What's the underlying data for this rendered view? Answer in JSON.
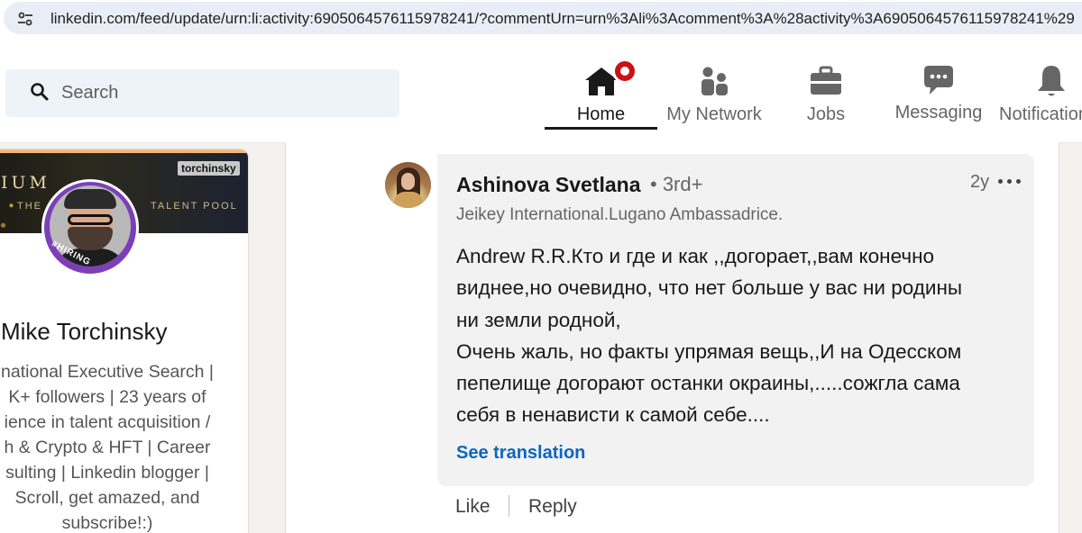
{
  "browser": {
    "url": "linkedin.com/feed/update/urn:li:activity:6905064576115978241/?commentUrn=urn%3Ali%3Acomment%3A%28activity%3A6905064576115978241%29"
  },
  "header": {
    "search_placeholder": "Search",
    "nav": {
      "home": "Home",
      "network": "My Network",
      "jobs": "Jobs",
      "messaging": "Messaging",
      "notifications": "Notifications"
    }
  },
  "profile": {
    "banner_title": "IUM",
    "banner_subtitle_left": "THE",
    "banner_subtitle_right": "TALENT POOL",
    "banner_tag": "torchinsky",
    "badge": "#HIRING",
    "name": "Mike Torchinsky",
    "headline_lines": [
      "national Executive Search |",
      "K+ followers | 23 years of",
      "ience in talent acquisition /",
      "h & Crypto & HFT | Career",
      "sulting | Linkedin blogger |",
      "Scroll, get amazed, and",
      "subscribe!:)"
    ]
  },
  "comment": {
    "author": "Ashinova Svetlana",
    "degree": "• 3rd+",
    "time": "2y",
    "author_headline": "Jeikey International.Lugano Ambassadrice.",
    "text_lines": [
      "Andrew R.R.Кто и где и как ,,догорает,,вам конечно",
      "виднее,но очевидно, что нет больше у вас ни родины",
      "ни земли родной,",
      "Очень жаль, но факты упрямая вещь,,И на Одесском",
      "пепелище догорают останки окраины,.....сожгла сама",
      "себя в ненависти к самой себе...."
    ],
    "see_translation": "See translation",
    "actions": {
      "like": "Like",
      "reply": "Reply"
    }
  },
  "icons": {
    "site_info": "tune-icon",
    "search": "search-icon",
    "home": "home-icon",
    "network": "people-icon",
    "jobs": "briefcase-icon",
    "messaging": "chat-icon",
    "notifications": "bell-icon",
    "more": "more-horizontal-icon"
  },
  "colors": {
    "accent_link": "#0a66c2",
    "notification_dot": "#cc1016",
    "hiring_frame": "#7c3fb8"
  }
}
